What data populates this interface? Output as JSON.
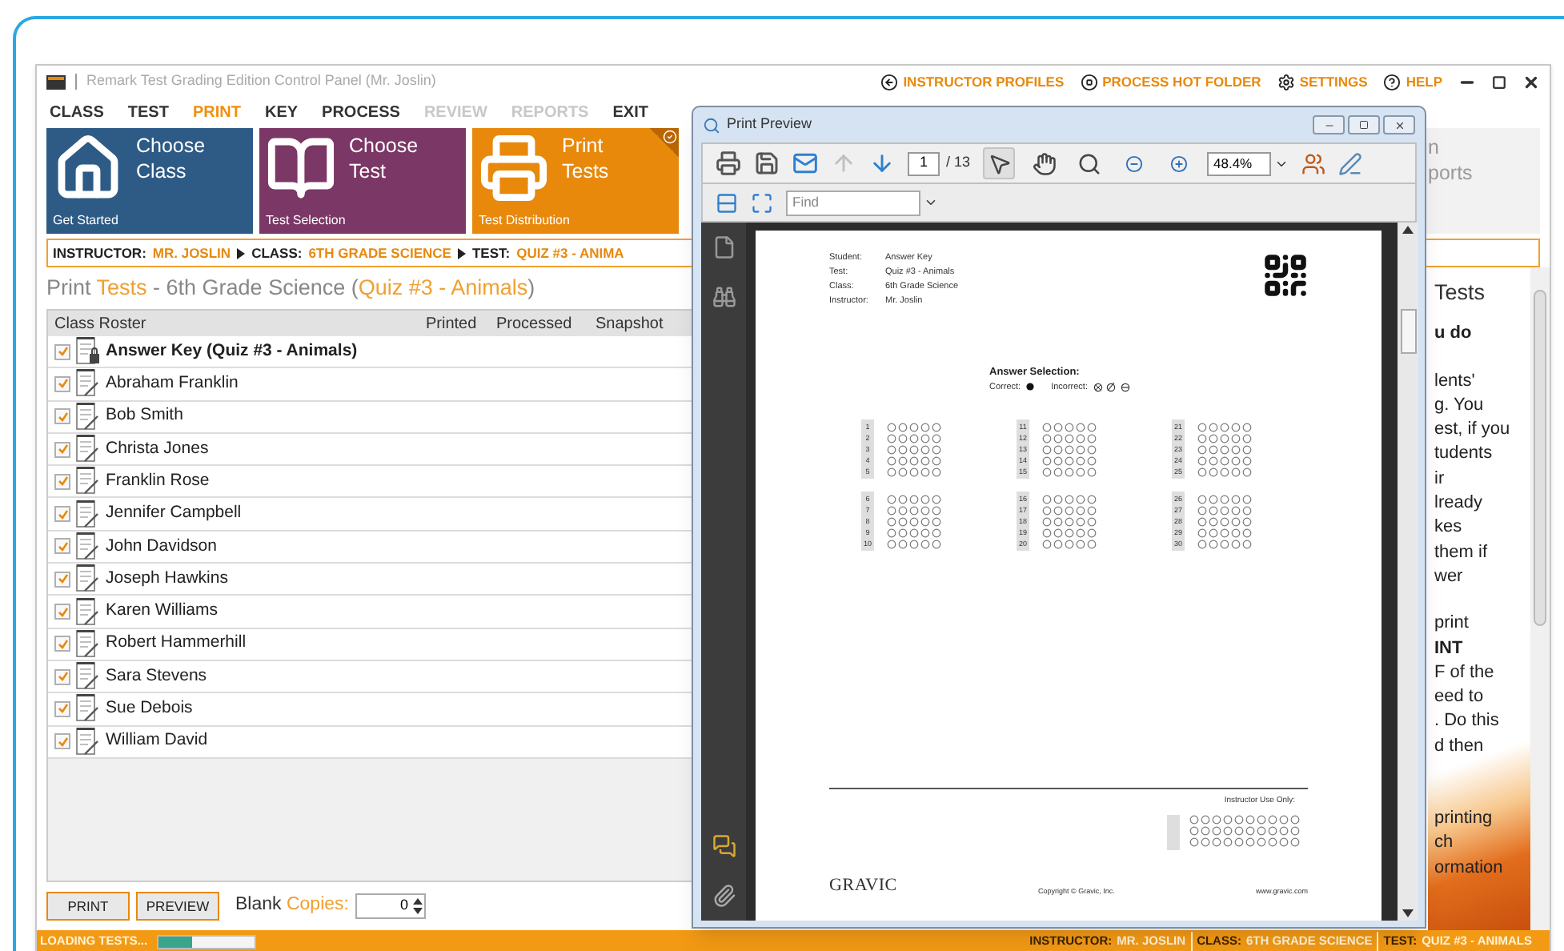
{
  "window": {
    "title": "Remark Test Grading Edition Control Panel (Mr. Joslin)"
  },
  "header_links": [
    {
      "label": "INSTRUCTOR PROFILES",
      "kind": "back"
    },
    {
      "label": "PROCESS HOT FOLDER",
      "kind": "stop"
    },
    {
      "label": "SETTINGS",
      "kind": "settings"
    },
    {
      "label": "HELP",
      "kind": "help"
    }
  ],
  "menu": [
    {
      "label": "CLASS",
      "selected": false,
      "disabled": false
    },
    {
      "label": "TEST",
      "selected": false,
      "disabled": false
    },
    {
      "label": "PRINT",
      "selected": true,
      "disabled": false
    },
    {
      "label": "KEY",
      "selected": false,
      "disabled": false
    },
    {
      "label": "PROCESS",
      "selected": false,
      "disabled": false
    },
    {
      "label": "REVIEW",
      "selected": false,
      "disabled": true
    },
    {
      "label": "REPORTS",
      "selected": false,
      "disabled": true
    },
    {
      "label": "EXIT",
      "selected": false,
      "disabled": false
    }
  ],
  "tiles": [
    {
      "title": "Choose Class",
      "subtitle": "Get Started",
      "kind": "house",
      "color": "#2d5b86",
      "selected": false
    },
    {
      "title": "Choose Test",
      "subtitle": "Test Selection",
      "kind": "book",
      "color": "#7b3766",
      "selected": false
    },
    {
      "title": "Print Tests",
      "subtitle": "Test Distribution",
      "kind": "printer",
      "color": "#e8890c",
      "selected": true
    }
  ],
  "faded_tile": {
    "lines": [
      "n",
      "ports"
    ]
  },
  "breadcrumb": [
    {
      "label": "INSTRUCTOR:",
      "value": "MR. JOSLIN"
    },
    {
      "label": "CLASS:",
      "value": "6TH GRADE SCIENCE"
    },
    {
      "label": "TEST:",
      "value": "QUIZ #3 - ANIMA"
    }
  ],
  "heading": [
    {
      "text": "Print ",
      "accent": false
    },
    {
      "text": "Tests",
      "accent": true
    },
    {
      "text": " - 6th Grade Science (",
      "accent": false
    },
    {
      "text": "Quiz #3 - Animals",
      "accent": true
    },
    {
      "text": ")",
      "accent": false
    }
  ],
  "roster": {
    "columns": [
      "Class Roster",
      "Printed",
      "Processed",
      "Snapshot"
    ],
    "rows": [
      {
        "name": "Answer Key (Quiz #3 - Animals)",
        "kind": "key",
        "checked": true
      },
      {
        "name": "Abraham Franklin",
        "kind": "student",
        "checked": true
      },
      {
        "name": "Bob Smith",
        "kind": "student",
        "checked": true
      },
      {
        "name": "Christa Jones",
        "kind": "student",
        "checked": true
      },
      {
        "name": "Franklin Rose",
        "kind": "student",
        "checked": true
      },
      {
        "name": "Jennifer Campbell",
        "kind": "student",
        "checked": true
      },
      {
        "name": "John Davidson",
        "kind": "student",
        "checked": true
      },
      {
        "name": "Joseph Hawkins",
        "kind": "student",
        "checked": true
      },
      {
        "name": "Karen Williams",
        "kind": "student",
        "checked": true
      },
      {
        "name": "Robert Hammerhill",
        "kind": "student",
        "checked": true
      },
      {
        "name": "Sara Stevens",
        "kind": "student",
        "checked": true
      },
      {
        "name": "Sue Debois",
        "kind": "student",
        "checked": true
      },
      {
        "name": "William David",
        "kind": "student",
        "checked": true
      }
    ]
  },
  "bottom": {
    "buttons": [
      "PRINT",
      "PREVIEW"
    ],
    "copies_label": [
      {
        "text": "Blank ",
        "accent": false
      },
      {
        "text": "Copies:",
        "accent": true
      }
    ],
    "copies_value": "0"
  },
  "help_panel": {
    "title": "Tests",
    "paragraphs": [
      [
        {
          "text": "u do",
          "bold": true
        }
      ],
      [
        {
          "text": "lents'",
          "bold": false
        },
        {
          "text": "g. You",
          "bold": false
        },
        {
          "text": "est, if you",
          "bold": false
        },
        {
          "text": "tudents",
          "bold": false
        },
        {
          "text": "ir",
          "bold": false
        },
        {
          "text": "lready",
          "bold": false
        },
        {
          "text": "kes",
          "bold": false
        },
        {
          "text": "them if",
          "bold": false
        },
        {
          "text": "wer",
          "bold": false
        }
      ],
      [
        {
          "text": "print",
          "bold": false
        },
        {
          "text": "INT",
          "bold": true
        },
        {
          "text": "F of the",
          "bold": false
        },
        {
          "text": "eed to",
          "bold": false
        },
        {
          "text": ". Do this",
          "bold": false
        },
        {
          "text": "d then",
          "bold": false
        }
      ],
      [
        {
          "text": "printing",
          "bold": false
        },
        {
          "text": "ch",
          "bold": false
        },
        {
          "text": "ormation",
          "bold": false
        }
      ]
    ]
  },
  "status_bar": {
    "loading": "LOADING TESTS...",
    "level": 0.35,
    "items": [
      {
        "label": "INSTRUCTOR:",
        "value": "MR. JOSLIN"
      },
      {
        "label": "CLASS:",
        "value": "6TH GRADE SCIENCE"
      },
      {
        "label": "TEST:",
        "value": "QUIZ #3 - ANIMALS"
      }
    ]
  },
  "preview": {
    "title": "Print Preview",
    "tools": [
      {
        "kind": "print",
        "disabled": false,
        "selected": false
      },
      {
        "kind": "save",
        "disabled": false,
        "selected": false
      },
      {
        "kind": "email",
        "disabled": false,
        "selected": false
      },
      {
        "kind": "up",
        "disabled": true,
        "selected": false
      },
      {
        "kind": "down",
        "disabled": false,
        "selected": false
      }
    ],
    "page_field": "1",
    "page_total": "/ 13",
    "mode_tools": [
      {
        "kind": "select",
        "selected": true
      },
      {
        "kind": "hand",
        "selected": false
      },
      {
        "kind": "zoom",
        "selected": false
      },
      {
        "kind": "zoom-out",
        "selected": false
      },
      {
        "kind": "zoom-in",
        "selected": false
      }
    ],
    "zoom": "48.4%",
    "find_placeholder": "Find",
    "page": {
      "fields": [
        {
          "label": "Student:",
          "value": "Answer Key"
        },
        {
          "label": "Test:",
          "value": "Quiz #3 - Animals"
        },
        {
          "label": "Class:",
          "value": "6th Grade Science"
        },
        {
          "label": "Instructor:",
          "value": "Mr. Joslin"
        }
      ],
      "answer_title": "Answer Selection:",
      "correct": "Correct:",
      "incorrect": "Incorrect:",
      "blocks": [
        [
          "1",
          "2",
          "3",
          "4",
          "5"
        ],
        [
          "11",
          "12",
          "13",
          "14",
          "15"
        ],
        [
          "21",
          "22",
          "23",
          "24",
          "25"
        ],
        [
          "6",
          "7",
          "8",
          "9",
          "10"
        ],
        [
          "16",
          "17",
          "18",
          "19",
          "20"
        ],
        [
          "26",
          "27",
          "28",
          "29",
          "30"
        ]
      ],
      "instructor_use": "Instructor Use Only:",
      "logo": "GRAVIC",
      "copyright": "Copyright © Gravic, Inc.",
      "url": "www.gravic.com"
    }
  }
}
